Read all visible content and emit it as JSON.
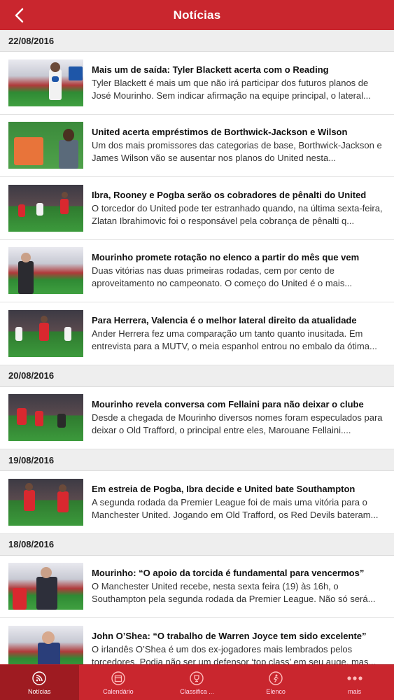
{
  "header": {
    "title": "Notícias"
  },
  "feed": {
    "groups": [
      {
        "date": "22/08/2016",
        "articles": [
          {
            "title": "Mais um de saída: Tyler Blackett acerta com o Reading",
            "summary": "Tyler Blackett é mais um que não irá participar dos futuros planos de José Mourinho. Sem indicar afirmação na equipe principal, o lateral..."
          },
          {
            "title": "United acerta empréstimos de Borthwick-Jackson e Wilson",
            "summary": "Um dos mais promissores das categorias de base, Borthwick-Jackson e James Wilson vão se ausentar nos planos do United nesta..."
          },
          {
            "title": "Ibra, Rooney e Pogba serão os cobradores de pênalti do United",
            "summary": "O torcedor do United pode ter estranhado quando, na última sexta-feira, Zlatan Ibrahimovic foi o responsável pela cobrança de pênalti q..."
          },
          {
            "title": "Mourinho promete rotação no elenco a partir do mês que vem",
            "summary": "Duas vitórias nas duas primeiras rodadas, cem por cento de aproveitamento no campeonato. O começo do United é o mais..."
          },
          {
            "title": "Para Herrera, Valencia é o melhor lateral direito da atualidade",
            "summary": "Ander Herrera fez uma comparação um tanto quanto inusitada. Em entrevista para a MUTV, o meia espanhol entrou no embalo da ótima..."
          }
        ]
      },
      {
        "date": "20/08/2016",
        "articles": [
          {
            "title": "Mourinho revela conversa com Fellaini para não deixar o clube",
            "summary": "Desde a chegada de Mourinho diversos nomes foram especulados para deixar o Old Trafford, o principal entre eles, Marouane Fellaini...."
          }
        ]
      },
      {
        "date": "19/08/2016",
        "articles": [
          {
            "title": "Em estreia de Pogba, Ibra decide e United bate Southampton",
            "summary": "A segunda rodada da Premier League foi de mais uma vitória para o Manchester United. Jogando em Old Trafford, os Red Devils bateram..."
          }
        ]
      },
      {
        "date": "18/08/2016",
        "articles": [
          {
            "title": "Mourinho: “O apoio da torcida é fundamental para vencermos”",
            "summary": "O Manchester United recebe, nesta sexta feira (19) às 16h, o Southampton pela segunda rodada da Premier League. Não só será..."
          },
          {
            "title": "John O’Shea: “O trabalho de Warren Joyce tem sido excelente”",
            "summary": "O irlandês O’Shea é um dos ex-jogadores mais lembrados pelos torcedores. Podia não ser um defensor ‘top class’ em seu auge, mas..."
          }
        ]
      }
    ]
  },
  "tabbar": {
    "items": [
      {
        "label": "Notícias",
        "icon": "rss-icon",
        "active": true
      },
      {
        "label": "Calendário",
        "icon": "calendar-icon",
        "active": false
      },
      {
        "label": "Classifica ...",
        "icon": "trophy-icon",
        "active": false
      },
      {
        "label": "Elenco",
        "icon": "player-icon",
        "active": false
      },
      {
        "label": "mais",
        "icon": "more-icon",
        "active": false
      }
    ]
  },
  "colors": {
    "brand": "#c9262e",
    "tab_active": "#9e1b21",
    "date_bg": "#eeeeee"
  }
}
